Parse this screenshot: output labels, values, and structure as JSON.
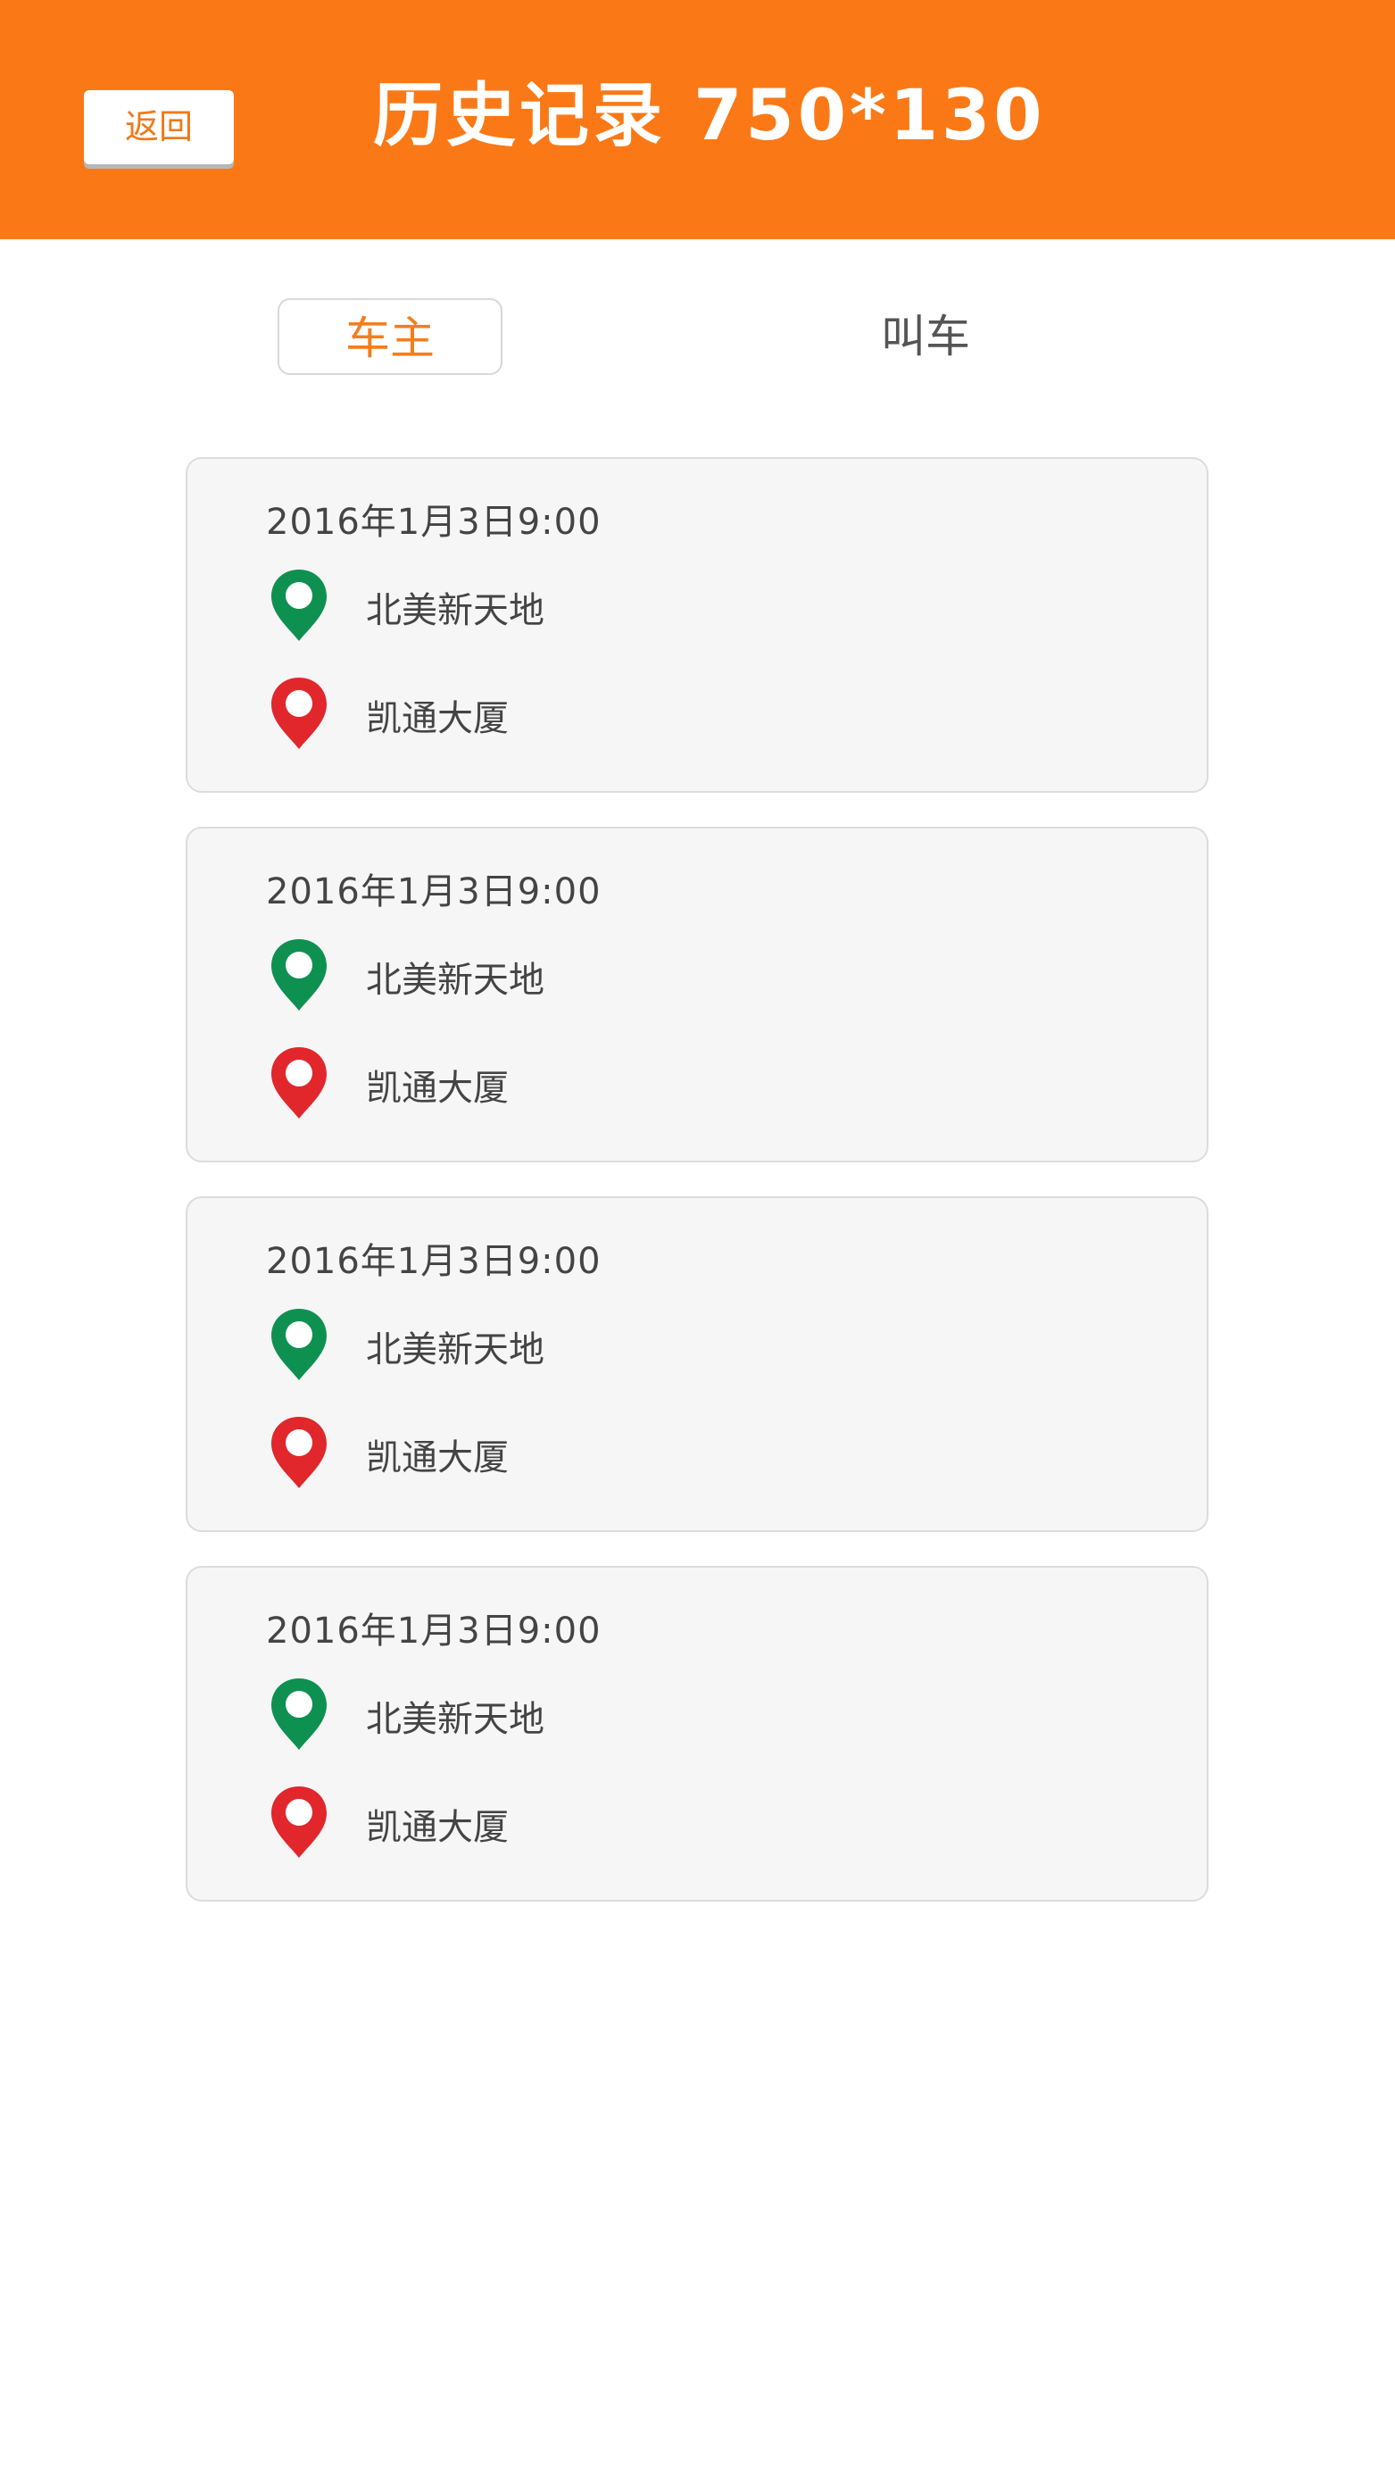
{
  "header": {
    "back_label": "返回",
    "title": "历史记录 750*130",
    "background_color": "#fa7916"
  },
  "tabs": [
    {
      "label": "车主",
      "active": true
    },
    {
      "label": "叫车",
      "active": false
    }
  ],
  "records": [
    {
      "datetime": "2016年1月3日9:00",
      "start": "北美新天地",
      "end": "凯通大厦"
    },
    {
      "datetime": "2016年1月3日9:00",
      "start": "北美新天地",
      "end": "凯通大厦"
    },
    {
      "datetime": "2016年1月3日9:00",
      "start": "北美新天地",
      "end": "凯通大厦"
    },
    {
      "datetime": "2016年1月3日9:00",
      "start": "北美新天地",
      "end": "凯通大厦"
    }
  ],
  "icons": {
    "start": "location-pin-icon",
    "end": "location-pin-icon"
  },
  "colors": {
    "accent": "#f57d1c",
    "start_pin": "#0e9150",
    "end_pin": "#e1272b"
  }
}
